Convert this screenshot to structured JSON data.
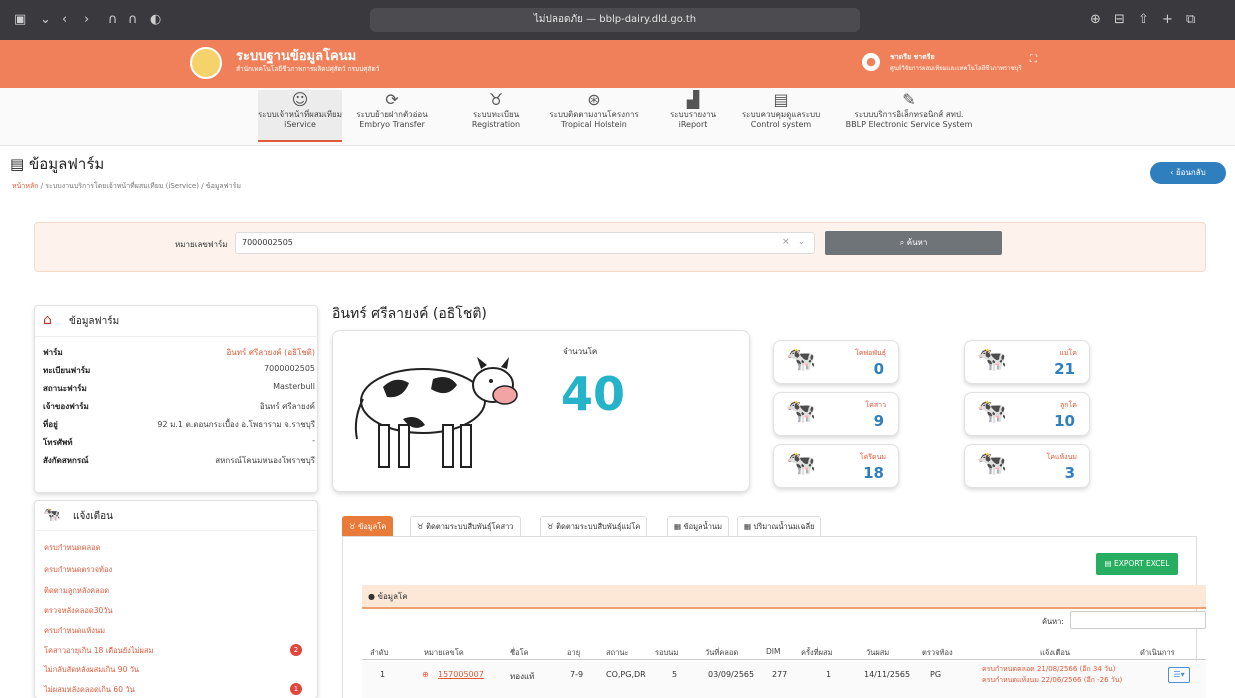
{
  "browser": {
    "url": "ไม่ปลอดภัย — bblp-dairy.dld.go.th"
  },
  "header": {
    "title": "ระบบฐานข้อมูลโคนม",
    "subtitle": "สำนักเทคโนโลยีชีวภาพการผลิตปศุสัตว์ กรมปศุสัตว์",
    "user_name": "ชาตรีย ชาตรีย",
    "user_org": "ศูนย์วิจัยการผสมเทียมและเทคโนโลยีชีวภาพราชบุรี"
  },
  "nav": [
    {
      "th": "ระบบเจ้าหน้าที่ผสมเทียม",
      "en": "iService"
    },
    {
      "th": "ระบบย้ายฝากตัวอ่อน",
      "en": "Embryo Transfer"
    },
    {
      "th": "ระบบทะเบียน",
      "en": "Registration"
    },
    {
      "th": "ระบบติดตามงานโครงการ",
      "en": "Tropical Holstein"
    },
    {
      "th": "ระบบรายงาน",
      "en": "iReport"
    },
    {
      "th": "ระบบควบคุมดูแลระบบ",
      "en": "Control system"
    },
    {
      "th": "ระบบบริการอิเล็กทรอนิกส์ สทป.",
      "en": "BBLP Electronic Service System"
    }
  ],
  "page": {
    "title": "ข้อมูลฟาร์ม",
    "back": "ย้อนกลับ",
    "breadcrumb": [
      "หน้าหลัก",
      "ระบบงานบริการโดยเจ้าหน้าที่ผสมเทียม (iService)",
      "ข้อมูลฟาร์ม"
    ]
  },
  "search": {
    "label": "หมายเลขฟาร์ม",
    "value": "7000002505",
    "clear": "×",
    "button": "ค้นหา"
  },
  "farm": {
    "panel_title": "ข้อมูลฟาร์ม",
    "rows": [
      {
        "k": "ฟาร์ม",
        "v": "อินทร์ ศรีลายงค์ (อธิโชติ)"
      },
      {
        "k": "ทะเบียนฟาร์ม",
        "v": "7000002505"
      },
      {
        "k": "สถานะฟาร์ม",
        "v": "Masterbull"
      },
      {
        "k": "เจ้าของฟาร์ม",
        "v": "อินทร์ ศรีลายงค์"
      },
      {
        "k": "ที่อยู่",
        "v": "92 ม.1 ต.ดอนกระเบื้อง อ.โพธาราม จ.ราชบุรี"
      },
      {
        "k": "โทรศัพท์",
        "v": "-"
      },
      {
        "k": "สังกัดสหกรณ์",
        "v": "สหกรณ์โคนมหนองโพราชบุรี"
      }
    ]
  },
  "alerts": {
    "title": "แจ้งเตือน",
    "items": [
      {
        "t": "ครบกำหนดคลอด",
        "b": ""
      },
      {
        "t": "ครบกำหนดตรวจท้อง",
        "b": ""
      },
      {
        "t": "ติดตามลูกหลังคลอด",
        "b": ""
      },
      {
        "t": "ตรวจหลังคลอด30วัน",
        "b": ""
      },
      {
        "t": "ครบกำหนดแห้งนม",
        "b": ""
      },
      {
        "t": "โคสาวอายุเกิน 18 เดือนยังไม่ผสม",
        "b": "2"
      },
      {
        "t": "ไม่กลับสัดหลังผสมเกิน 90 วัน",
        "b": ""
      },
      {
        "t": "ไม่ผสมหลังคลอดเกิน 60 วัน",
        "b": "1"
      }
    ]
  },
  "owner_name": "อินทร์ ศรีลายงค์ (อธิโชติ)",
  "total": {
    "label": "จำนวนโค",
    "value": "40"
  },
  "stats": [
    {
      "label": "โคพ่อพันธุ์",
      "value": "0",
      "icon": "🐄"
    },
    {
      "label": "แม่โค",
      "value": "21",
      "icon": "🐄"
    },
    {
      "label": "โคสาว",
      "value": "9",
      "icon": "🐄"
    },
    {
      "label": "ลูกโค",
      "value": "10",
      "icon": "🐄"
    },
    {
      "label": "โครีดนม",
      "value": "18",
      "icon": "🐄"
    },
    {
      "label": "โคแห้งนม",
      "value": "3",
      "icon": "🐄"
    }
  ],
  "tabs": [
    "ข้อมูลโค",
    "ติดตามระบบสืบพันธุ์โคสาว",
    "ติดตามระบบสืบพันธุ์แม่โค",
    "ข้อมูลน้ำนม",
    "ปริมาณน้ำนมเฉลี่ย"
  ],
  "table": {
    "export": "EXPORT EXCEL",
    "section": "ข้อมูลโค",
    "search_label": "ค้นหา:",
    "headers": [
      "ลำดับ",
      "หมายเลขโค",
      "ชื่อโค",
      "อายุ",
      "สถานะ",
      "รอบนม",
      "วันที่คลอด",
      "DIM",
      "ครั้งที่ผสม",
      "วันผสม",
      "ตรวจท้อง",
      "แจ้งเตือน",
      "ดำเนินการ"
    ],
    "row": {
      "no": "1",
      "id": "157005007",
      "name": "ทองแท้",
      "age": "7-9",
      "status": "CO,PG,DR",
      "lact": "5",
      "calving": "03/09/2565",
      "dim": "277",
      "times": "1",
      "bred": "14/11/2565",
      "preg": "PG",
      "alert1": "ครบกำหนดคลอด 21/08/2566 (อีก 34 วัน)",
      "alert2": "ครบกำหนดแห้งนม 22/06/2566 (อีก -26 วัน)"
    }
  }
}
